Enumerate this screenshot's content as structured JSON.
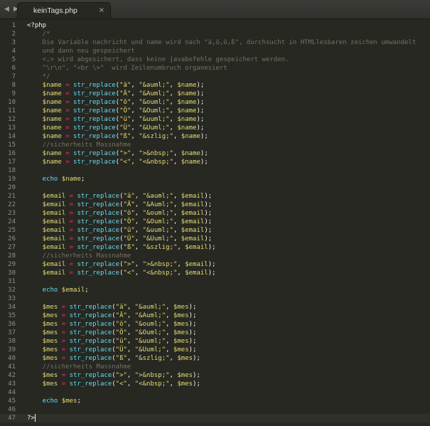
{
  "tabbar": {
    "nav_left": "◀",
    "nav_right": "▶",
    "tab_title": "keinTags.php",
    "close_glyph": "×"
  },
  "colors": {
    "background": "#272822",
    "line_number": "#8f908a",
    "comment": "#75715e",
    "variable": "#e6db74",
    "operator": "#f92672",
    "function": "#66d9ef",
    "string": "#e6db74",
    "keyword": "#66d9ef",
    "text": "#f8f8f2"
  },
  "editor": {
    "current_line": 47,
    "lines": [
      [
        [
          "t-tag",
          "<?php"
        ]
      ],
      [
        [
          "t-comment",
          "    /*"
        ]
      ],
      [
        [
          "t-comment",
          "    Die Variable nachricht und name wird nach \"ä,ö,ö,ß\", durchsucht in HTMLlesbaren zeichen umwandelt"
        ]
      ],
      [
        [
          "t-comment",
          "    und dann neu gespeichert"
        ]
      ],
      [
        [
          "t-comment",
          "    <,> wird abgesichert, dass keine javabefehle gespeichert werden."
        ]
      ],
      [
        [
          "t-comment",
          "    \"\\r\\n\", \"<br \\>\"  wird Zeilenumbruch organesiert"
        ]
      ],
      [
        [
          "t-comment",
          "    */"
        ]
      ],
      [
        [
          "t-var",
          "    $name"
        ],
        [
          "t-op",
          " = "
        ],
        [
          "t-func",
          "str_replace"
        ],
        [
          "t-plain",
          "("
        ],
        [
          "t-str",
          "\"ä\""
        ],
        [
          "t-plain",
          ", "
        ],
        [
          "t-str",
          "\"&auml;\""
        ],
        [
          "t-plain",
          ", "
        ],
        [
          "t-var",
          "$name"
        ],
        [
          "t-plain",
          ");"
        ]
      ],
      [
        [
          "t-var",
          "    $name"
        ],
        [
          "t-op",
          " = "
        ],
        [
          "t-func",
          "str_replace"
        ],
        [
          "t-plain",
          "("
        ],
        [
          "t-str",
          "\"Ä\""
        ],
        [
          "t-plain",
          ", "
        ],
        [
          "t-str",
          "\"&Auml;\""
        ],
        [
          "t-plain",
          ", "
        ],
        [
          "t-var",
          "$name"
        ],
        [
          "t-plain",
          ");"
        ]
      ],
      [
        [
          "t-var",
          "    $name"
        ],
        [
          "t-op",
          " = "
        ],
        [
          "t-func",
          "str_replace"
        ],
        [
          "t-plain",
          "("
        ],
        [
          "t-str",
          "\"ö\""
        ],
        [
          "t-plain",
          ", "
        ],
        [
          "t-str",
          "\"&ouml;\""
        ],
        [
          "t-plain",
          ", "
        ],
        [
          "t-var",
          "$name"
        ],
        [
          "t-plain",
          ");"
        ]
      ],
      [
        [
          "t-var",
          "    $name"
        ],
        [
          "t-op",
          " = "
        ],
        [
          "t-func",
          "str_replace"
        ],
        [
          "t-plain",
          "("
        ],
        [
          "t-str",
          "\"Ö\""
        ],
        [
          "t-plain",
          ", "
        ],
        [
          "t-str",
          "\"&Ouml;\""
        ],
        [
          "t-plain",
          ", "
        ],
        [
          "t-var",
          "$name"
        ],
        [
          "t-plain",
          ");"
        ]
      ],
      [
        [
          "t-var",
          "    $name"
        ],
        [
          "t-op",
          " = "
        ],
        [
          "t-func",
          "str_replace"
        ],
        [
          "t-plain",
          "("
        ],
        [
          "t-str",
          "\"ü\""
        ],
        [
          "t-plain",
          ", "
        ],
        [
          "t-str",
          "\"&uuml;\""
        ],
        [
          "t-plain",
          ", "
        ],
        [
          "t-var",
          "$name"
        ],
        [
          "t-plain",
          ");"
        ]
      ],
      [
        [
          "t-var",
          "    $name"
        ],
        [
          "t-op",
          " = "
        ],
        [
          "t-func",
          "str_replace"
        ],
        [
          "t-plain",
          "("
        ],
        [
          "t-str",
          "\"Ü\""
        ],
        [
          "t-plain",
          ", "
        ],
        [
          "t-str",
          "\"&Uuml;\""
        ],
        [
          "t-plain",
          ", "
        ],
        [
          "t-var",
          "$name"
        ],
        [
          "t-plain",
          ");"
        ]
      ],
      [
        [
          "t-var",
          "    $name"
        ],
        [
          "t-op",
          " = "
        ],
        [
          "t-func",
          "str_replace"
        ],
        [
          "t-plain",
          "("
        ],
        [
          "t-str",
          "\"ß\""
        ],
        [
          "t-plain",
          ", "
        ],
        [
          "t-str",
          "\"&szlig;\""
        ],
        [
          "t-plain",
          ", "
        ],
        [
          "t-var",
          "$name"
        ],
        [
          "t-plain",
          ");"
        ]
      ],
      [
        [
          "t-comment",
          "    //sicherheits Massnahme"
        ]
      ],
      [
        [
          "t-var",
          "    $name"
        ],
        [
          "t-op",
          " = "
        ],
        [
          "t-func",
          "str_replace"
        ],
        [
          "t-plain",
          "("
        ],
        [
          "t-str",
          "\">\""
        ],
        [
          "t-plain",
          ", "
        ],
        [
          "t-str",
          "\">&nbsp;\""
        ],
        [
          "t-plain",
          ", "
        ],
        [
          "t-var",
          "$name"
        ],
        [
          "t-plain",
          ");"
        ]
      ],
      [
        [
          "t-var",
          "    $name"
        ],
        [
          "t-op",
          " = "
        ],
        [
          "t-func",
          "str_replace"
        ],
        [
          "t-plain",
          "("
        ],
        [
          "t-str",
          "\"<\""
        ],
        [
          "t-plain",
          ", "
        ],
        [
          "t-str",
          "\"<&nbsp;\""
        ],
        [
          "t-plain",
          ", "
        ],
        [
          "t-var",
          "$name"
        ],
        [
          "t-plain",
          ");"
        ]
      ],
      [],
      [
        [
          "t-kw",
          "    echo "
        ],
        [
          "t-var",
          "$name"
        ],
        [
          "t-plain",
          ";"
        ]
      ],
      [],
      [
        [
          "t-var",
          "    $email"
        ],
        [
          "t-op",
          " = "
        ],
        [
          "t-func",
          "str_replace"
        ],
        [
          "t-plain",
          "("
        ],
        [
          "t-str",
          "\"ä\""
        ],
        [
          "t-plain",
          ", "
        ],
        [
          "t-str",
          "\"&auml;\""
        ],
        [
          "t-plain",
          ", "
        ],
        [
          "t-var",
          "$email"
        ],
        [
          "t-plain",
          ");"
        ]
      ],
      [
        [
          "t-var",
          "    $email"
        ],
        [
          "t-op",
          " = "
        ],
        [
          "t-func",
          "str_replace"
        ],
        [
          "t-plain",
          "("
        ],
        [
          "t-str",
          "\"Ä\""
        ],
        [
          "t-plain",
          ", "
        ],
        [
          "t-str",
          "\"&Auml;\""
        ],
        [
          "t-plain",
          ", "
        ],
        [
          "t-var",
          "$email"
        ],
        [
          "t-plain",
          ");"
        ]
      ],
      [
        [
          "t-var",
          "    $email"
        ],
        [
          "t-op",
          " = "
        ],
        [
          "t-func",
          "str_replace"
        ],
        [
          "t-plain",
          "("
        ],
        [
          "t-str",
          "\"ö\""
        ],
        [
          "t-plain",
          ", "
        ],
        [
          "t-str",
          "\"&ouml;\""
        ],
        [
          "t-plain",
          ", "
        ],
        [
          "t-var",
          "$email"
        ],
        [
          "t-plain",
          ");"
        ]
      ],
      [
        [
          "t-var",
          "    $email"
        ],
        [
          "t-op",
          " = "
        ],
        [
          "t-func",
          "str_replace"
        ],
        [
          "t-plain",
          "("
        ],
        [
          "t-str",
          "\"Ö\""
        ],
        [
          "t-plain",
          ", "
        ],
        [
          "t-str",
          "\"&Ouml;\""
        ],
        [
          "t-plain",
          ", "
        ],
        [
          "t-var",
          "$email"
        ],
        [
          "t-plain",
          ");"
        ]
      ],
      [
        [
          "t-var",
          "    $email"
        ],
        [
          "t-op",
          " = "
        ],
        [
          "t-func",
          "str_replace"
        ],
        [
          "t-plain",
          "("
        ],
        [
          "t-str",
          "\"ü\""
        ],
        [
          "t-plain",
          ", "
        ],
        [
          "t-str",
          "\"&uuml;\""
        ],
        [
          "t-plain",
          ", "
        ],
        [
          "t-var",
          "$email"
        ],
        [
          "t-plain",
          ");"
        ]
      ],
      [
        [
          "t-var",
          "    $email"
        ],
        [
          "t-op",
          " = "
        ],
        [
          "t-func",
          "str_replace"
        ],
        [
          "t-plain",
          "("
        ],
        [
          "t-str",
          "\"Ü\""
        ],
        [
          "t-plain",
          ", "
        ],
        [
          "t-str",
          "\"&Uuml;\""
        ],
        [
          "t-plain",
          ", "
        ],
        [
          "t-var",
          "$email"
        ],
        [
          "t-plain",
          ");"
        ]
      ],
      [
        [
          "t-var",
          "    $email"
        ],
        [
          "t-op",
          " = "
        ],
        [
          "t-func",
          "str_replace"
        ],
        [
          "t-plain",
          "("
        ],
        [
          "t-str",
          "\"ß\""
        ],
        [
          "t-plain",
          ", "
        ],
        [
          "t-str",
          "\"&szlig;\""
        ],
        [
          "t-plain",
          ", "
        ],
        [
          "t-var",
          "$email"
        ],
        [
          "t-plain",
          ");"
        ]
      ],
      [
        [
          "t-comment",
          "    //sicherheits Massnahme"
        ]
      ],
      [
        [
          "t-var",
          "    $email"
        ],
        [
          "t-op",
          " = "
        ],
        [
          "t-func",
          "str_replace"
        ],
        [
          "t-plain",
          "("
        ],
        [
          "t-str",
          "\">\""
        ],
        [
          "t-plain",
          ", "
        ],
        [
          "t-str",
          "\">&nbsp;\""
        ],
        [
          "t-plain",
          ", "
        ],
        [
          "t-var",
          "$email"
        ],
        [
          "t-plain",
          ");"
        ]
      ],
      [
        [
          "t-var",
          "    $email"
        ],
        [
          "t-op",
          " = "
        ],
        [
          "t-func",
          "str_replace"
        ],
        [
          "t-plain",
          "("
        ],
        [
          "t-str",
          "\"<\""
        ],
        [
          "t-plain",
          ", "
        ],
        [
          "t-str",
          "\"<&nbsp;\""
        ],
        [
          "t-plain",
          ", "
        ],
        [
          "t-var",
          "$email"
        ],
        [
          "t-plain",
          ");"
        ]
      ],
      [],
      [
        [
          "t-kw",
          "    echo "
        ],
        [
          "t-var",
          "$email"
        ],
        [
          "t-plain",
          ";"
        ]
      ],
      [],
      [
        [
          "t-var",
          "    $mes"
        ],
        [
          "t-op",
          " = "
        ],
        [
          "t-func",
          "str_replace"
        ],
        [
          "t-plain",
          "("
        ],
        [
          "t-str",
          "\"ä\""
        ],
        [
          "t-plain",
          ", "
        ],
        [
          "t-str",
          "\"&auml;\""
        ],
        [
          "t-plain",
          ", "
        ],
        [
          "t-var",
          "$mes"
        ],
        [
          "t-plain",
          ");"
        ]
      ],
      [
        [
          "t-var",
          "    $mes"
        ],
        [
          "t-op",
          " = "
        ],
        [
          "t-func",
          "str_replace"
        ],
        [
          "t-plain",
          "("
        ],
        [
          "t-str",
          "\"Ä\""
        ],
        [
          "t-plain",
          ", "
        ],
        [
          "t-str",
          "\"&Auml;\""
        ],
        [
          "t-plain",
          ", "
        ],
        [
          "t-var",
          "$mes"
        ],
        [
          "t-plain",
          ");"
        ]
      ],
      [
        [
          "t-var",
          "    $mes"
        ],
        [
          "t-op",
          " = "
        ],
        [
          "t-func",
          "str_replace"
        ],
        [
          "t-plain",
          "("
        ],
        [
          "t-str",
          "\"ö\""
        ],
        [
          "t-plain",
          ", "
        ],
        [
          "t-str",
          "\"&ouml;\""
        ],
        [
          "t-plain",
          ", "
        ],
        [
          "t-var",
          "$mes"
        ],
        [
          "t-plain",
          ");"
        ]
      ],
      [
        [
          "t-var",
          "    $mes"
        ],
        [
          "t-op",
          " = "
        ],
        [
          "t-func",
          "str_replace"
        ],
        [
          "t-plain",
          "("
        ],
        [
          "t-str",
          "\"Ö\""
        ],
        [
          "t-plain",
          ", "
        ],
        [
          "t-str",
          "\"&Ouml;\""
        ],
        [
          "t-plain",
          ", "
        ],
        [
          "t-var",
          "$mes"
        ],
        [
          "t-plain",
          ");"
        ]
      ],
      [
        [
          "t-var",
          "    $mes"
        ],
        [
          "t-op",
          " = "
        ],
        [
          "t-func",
          "str_replace"
        ],
        [
          "t-plain",
          "("
        ],
        [
          "t-str",
          "\"ü\""
        ],
        [
          "t-plain",
          ", "
        ],
        [
          "t-str",
          "\"&uuml;\""
        ],
        [
          "t-plain",
          ", "
        ],
        [
          "t-var",
          "$mes"
        ],
        [
          "t-plain",
          ");"
        ]
      ],
      [
        [
          "t-var",
          "    $mes"
        ],
        [
          "t-op",
          " = "
        ],
        [
          "t-func",
          "str_replace"
        ],
        [
          "t-plain",
          "("
        ],
        [
          "t-str",
          "\"Ü\""
        ],
        [
          "t-plain",
          ", "
        ],
        [
          "t-str",
          "\"&Uuml;\""
        ],
        [
          "t-plain",
          ", "
        ],
        [
          "t-var",
          "$mes"
        ],
        [
          "t-plain",
          ");"
        ]
      ],
      [
        [
          "t-var",
          "    $mes"
        ],
        [
          "t-op",
          " = "
        ],
        [
          "t-func",
          "str_replace"
        ],
        [
          "t-plain",
          "("
        ],
        [
          "t-str",
          "\"ß\""
        ],
        [
          "t-plain",
          ", "
        ],
        [
          "t-str",
          "\"&szlig;\""
        ],
        [
          "t-plain",
          ", "
        ],
        [
          "t-var",
          "$mes"
        ],
        [
          "t-plain",
          ");"
        ]
      ],
      [
        [
          "t-comment",
          "    //sicherheits Massnahme"
        ]
      ],
      [
        [
          "t-var",
          "    $mes"
        ],
        [
          "t-op",
          " = "
        ],
        [
          "t-func",
          "str_replace"
        ],
        [
          "t-plain",
          "("
        ],
        [
          "t-str",
          "\">\""
        ],
        [
          "t-plain",
          ", "
        ],
        [
          "t-str",
          "\">&nbsp;\""
        ],
        [
          "t-plain",
          ", "
        ],
        [
          "t-var",
          "$mes"
        ],
        [
          "t-plain",
          ");"
        ]
      ],
      [
        [
          "t-var",
          "    $mes"
        ],
        [
          "t-op",
          " = "
        ],
        [
          "t-func",
          "str_replace"
        ],
        [
          "t-plain",
          "("
        ],
        [
          "t-str",
          "\"<\""
        ],
        [
          "t-plain",
          ", "
        ],
        [
          "t-str",
          "\"<&nbsp;\""
        ],
        [
          "t-plain",
          ", "
        ],
        [
          "t-var",
          "$mes"
        ],
        [
          "t-plain",
          ");"
        ]
      ],
      [],
      [
        [
          "t-kw",
          "    echo "
        ],
        [
          "t-var",
          "$mes"
        ],
        [
          "t-plain",
          ";"
        ]
      ],
      [],
      [
        [
          "t-tag",
          "?>"
        ]
      ]
    ]
  }
}
